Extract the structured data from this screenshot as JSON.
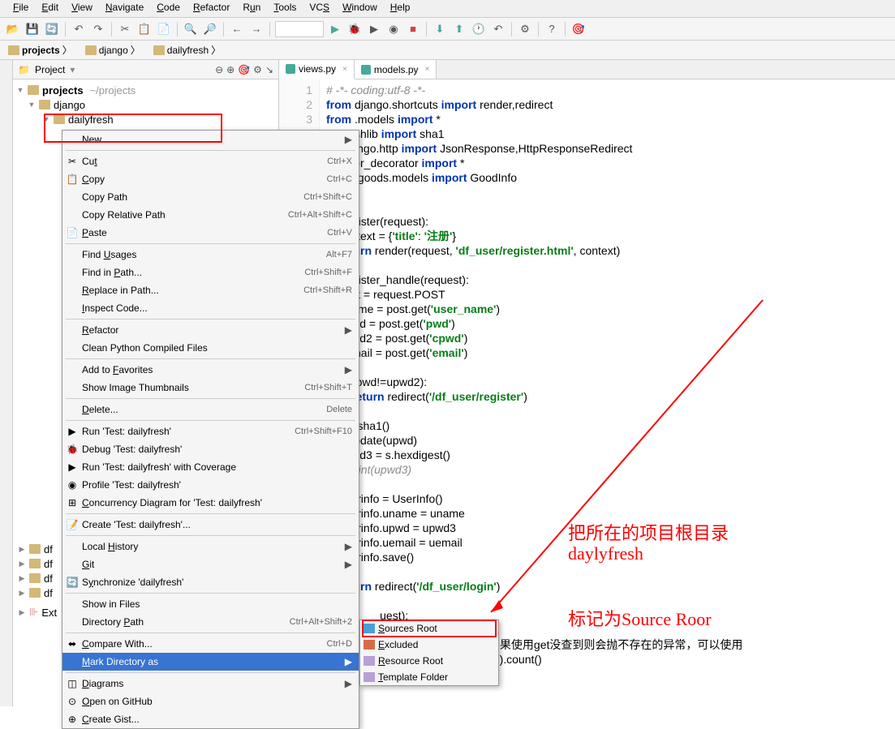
{
  "menubar": [
    "File",
    "Edit",
    "View",
    "Navigate",
    "Code",
    "Refactor",
    "Run",
    "Tools",
    "VCS",
    "Window",
    "Help"
  ],
  "breadcrumb": {
    "items": [
      "projects",
      "django",
      "dailyfresh"
    ]
  },
  "panel": {
    "title": "Project"
  },
  "tree": {
    "root": "projects",
    "root_path": "~/projects",
    "l1": "django",
    "l2": "dailyfresh"
  },
  "ext_tree": [
    "df",
    "df",
    "df",
    "df",
    "",
    "Ext"
  ],
  "context_menu": {
    "items": [
      {
        "label": "New",
        "sub": true
      },
      {
        "sep": true
      },
      {
        "icon": "✂",
        "label": "Cut",
        "sc": "Ctrl+X",
        "u": "t"
      },
      {
        "icon": "📋",
        "label": "Copy",
        "sc": "Ctrl+C",
        "u": "C"
      },
      {
        "label": "Copy Path",
        "sc": "Ctrl+Shift+C"
      },
      {
        "label": "Copy Relative Path",
        "sc": "Ctrl+Alt+Shift+C"
      },
      {
        "icon": "📄",
        "label": "Paste",
        "sc": "Ctrl+V",
        "u": "P"
      },
      {
        "sep": true
      },
      {
        "label": "Find Usages",
        "sc": "Alt+F7",
        "u": "U"
      },
      {
        "label": "Find in Path...",
        "sc": "Ctrl+Shift+F",
        "u": "P"
      },
      {
        "label": "Replace in Path...",
        "sc": "Ctrl+Shift+R",
        "u": "R"
      },
      {
        "label": "Inspect Code...",
        "u": "I"
      },
      {
        "sep": true
      },
      {
        "label": "Refactor",
        "sub": true,
        "u": "R"
      },
      {
        "label": "Clean Python Compiled Files"
      },
      {
        "sep": true
      },
      {
        "label": "Add to Favorites",
        "sub": true,
        "u": "F"
      },
      {
        "label": "Show Image Thumbnails",
        "sc": "Ctrl+Shift+T"
      },
      {
        "sep": true
      },
      {
        "label": "Delete...",
        "sc": "Delete",
        "u": "D"
      },
      {
        "sep": true
      },
      {
        "icon": "▶",
        "label": "Run 'Test: dailyfresh'",
        "sc": "Ctrl+Shift+F10",
        "color": "#4a9"
      },
      {
        "icon": "🐞",
        "label": "Debug 'Test: dailyfresh'",
        "color": "#4a9"
      },
      {
        "icon": "▶",
        "label": "Run 'Test: dailyfresh' with Coverage"
      },
      {
        "icon": "◉",
        "label": "Profile 'Test: dailyfresh'"
      },
      {
        "icon": "⊞",
        "label": "Concurrency Diagram for 'Test: dailyfresh'",
        "u": "C"
      },
      {
        "sep": true
      },
      {
        "icon": "📝",
        "label": "Create 'Test: dailyfresh'..."
      },
      {
        "sep": true
      },
      {
        "label": "Local History",
        "sub": true,
        "u": "H"
      },
      {
        "label": "Git",
        "sub": true,
        "u": "G"
      },
      {
        "icon": "🔄",
        "label": "Synchronize 'dailyfresh'",
        "u": "y"
      },
      {
        "sep": true
      },
      {
        "label": "Show in Files"
      },
      {
        "label": "Directory Path",
        "sc": "Ctrl+Alt+Shift+2",
        "u": "P"
      },
      {
        "sep": true
      },
      {
        "icon": "⬌",
        "label": "Compare With...",
        "sc": "Ctrl+D",
        "u": "C"
      },
      {
        "label": "Mark Directory as",
        "sub": true,
        "hl": true,
        "u": "M"
      },
      {
        "sep": true
      },
      {
        "icon": "◫",
        "label": "Diagrams",
        "sub": true,
        "u": "D"
      },
      {
        "icon": "⊙",
        "label": "Open on GitHub",
        "u": "O"
      },
      {
        "icon": "⊕",
        "label": "Create Gist...",
        "u": "C"
      }
    ]
  },
  "submenu": {
    "items": [
      {
        "label": "Sources Root",
        "cls": "blue",
        "u": "S"
      },
      {
        "label": "Excluded",
        "cls": "red",
        "u": "E"
      },
      {
        "label": "Resource Root",
        "cls": "purple",
        "u": "R"
      },
      {
        "label": "Template Folder",
        "cls": "purple",
        "u": "T"
      }
    ]
  },
  "tabs": [
    {
      "name": "views.py",
      "active": true
    },
    {
      "name": "models.py",
      "active": false
    }
  ],
  "code": {
    "lines": [
      "1",
      "2",
      "3"
    ],
    "text": "# -*- coding:utf-8 -*-\nfrom django.shortcuts import render,redirect\nfrom .models import *\n     hashlib import sha1\n     django.http import JsonResponse,HttpResponseRedirect\n     user_decorator import *\n     df_goods.models import GoodInfo\n\n\n     register(request):\n    context = {'title': '注册'}\n    return render(request, 'df_user/register.html', context)\n\n     register_handle(request):\n    post = request.POST\n    uname = post.get('user_name')\n    upwd = post.get('pwd')\n    upwd2 = post.get('cpwd')\n    uemail = post.get('email')\n\n    if(upwd!=upwd2):\n        return redirect('/df_user/register')\n\n    s = sha1()\n    s.update(upwd)\n    upwd3 = s.hexdigest()\n    # print(upwd3)\n\n    userinfo = UserInfo()\n    userinfo.uname = uname\n    userinfo.upwd = upwd3\n    userinfo.uemail = uemail\n    userinfo.save()\n\n    return redirect('/df_user/login')\n\n                 uest):\n                 ET.get('uname')\n                 ，没查到数据返回[]；如果使用get没查到则会抛不存在的异常，可以使用\n                 ts.filter(uname=uname1).count()"
  },
  "annotations": {
    "line1": "把所在的项目根目录",
    "line2": "daylyfresh",
    "line3": "标记为Source Roor"
  }
}
